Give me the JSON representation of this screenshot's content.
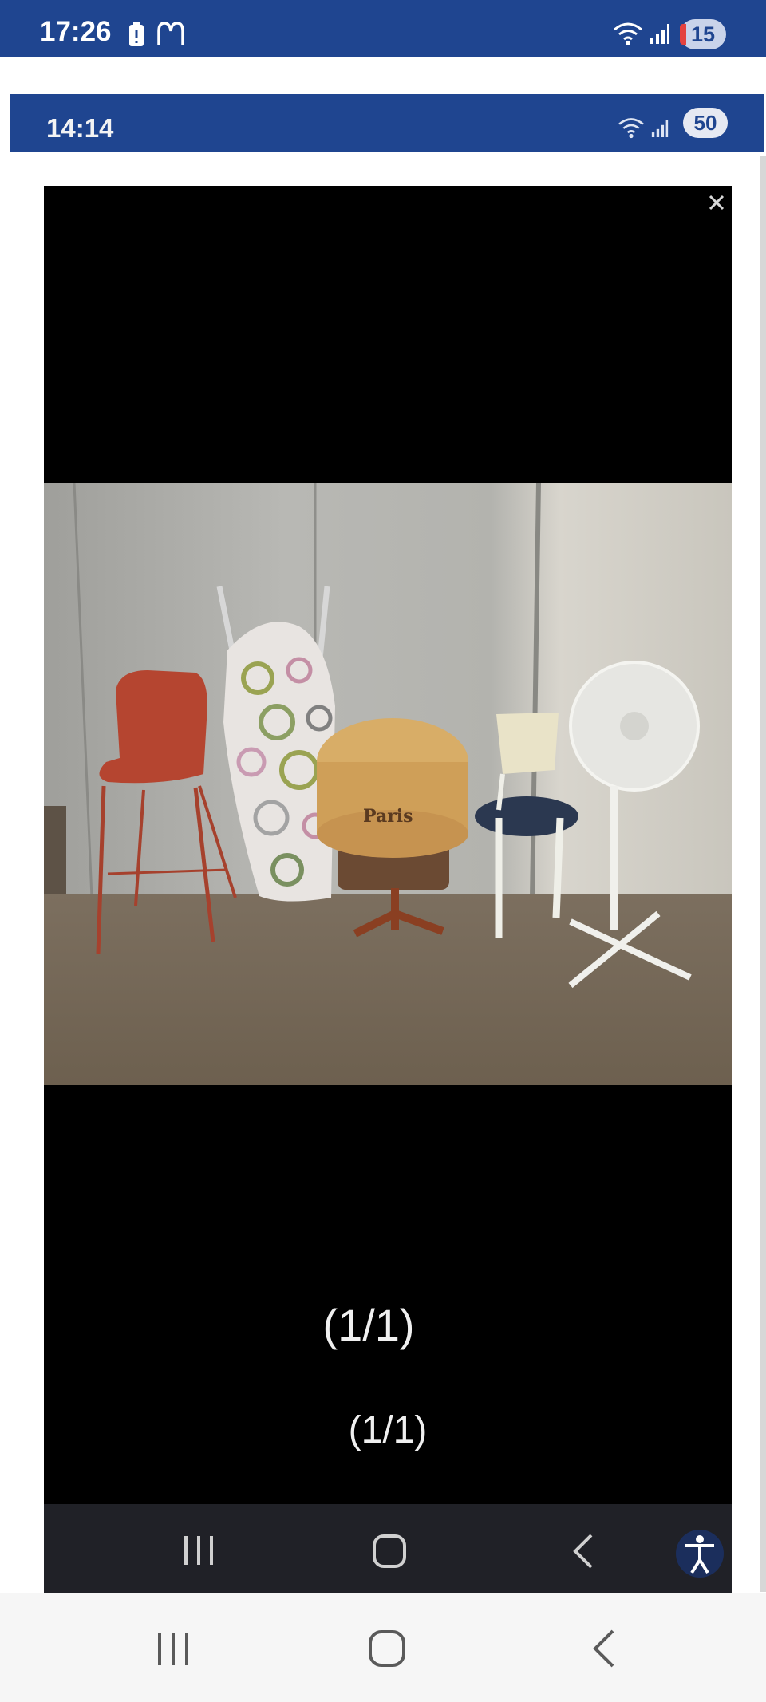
{
  "status_bar": {
    "time": "17:26",
    "notification_count": "15",
    "icons": [
      "battery-alert-icon",
      "mcdonalds-logo-icon",
      "wifi-icon",
      "signal-icon"
    ]
  },
  "inner_status_bar": {
    "time": "14:14",
    "notification_count": "50",
    "icons": [
      "wifi-icon",
      "signal-icon"
    ]
  },
  "overlay": {
    "close_icon": "close-icon"
  },
  "viewer": {
    "close_icon": "close-icon",
    "counter_primary": "(1/1)",
    "counter_secondary": "(1/1)",
    "photo_subject": "furniture-photo",
    "photo_label_visible": "Paris"
  },
  "navigation": {
    "inner": [
      "recent-apps-icon",
      "home-icon",
      "back-icon",
      "accessibility-icon"
    ],
    "outer": [
      "recent-apps-icon",
      "home-icon",
      "back-icon"
    ]
  },
  "colors": {
    "status_blue": "#1f4590",
    "viewer_black": "#000000",
    "nav_dark": "#202127",
    "nav_light": "#f6f6f6"
  }
}
